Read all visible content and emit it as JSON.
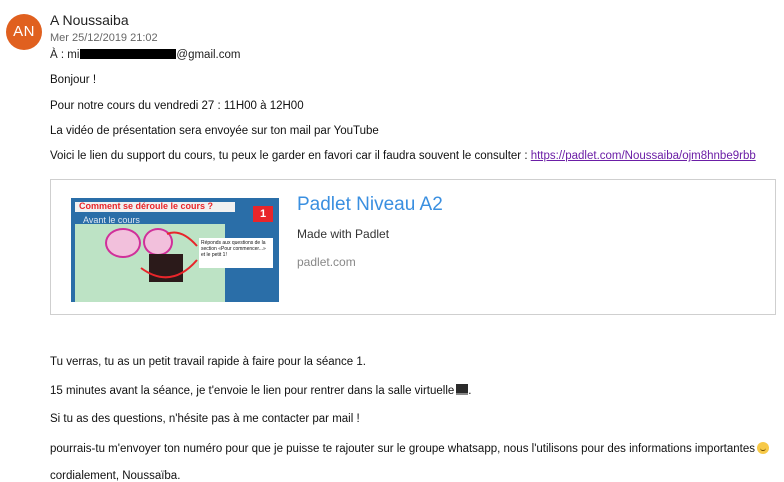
{
  "email": {
    "avatar_initials": "AN",
    "avatar_color": "#e0601f",
    "sender": "A Noussaiba",
    "date": "Mer 25/12/2019 21:02",
    "to_label": "À :",
    "to_prefix": "mi",
    "to_suffix": "@gmail.com",
    "body": {
      "greeting": "Bonjour !",
      "p1": "Pour notre cours du vendredi 27 : 11H00 à 12H00",
      "p2": "La vidéo de présentation sera envoyée sur ton mail par YouTube",
      "p3_text": "Voici le lien du support du cours, tu peux le garder en favori car il faudra souvent le consulter : ",
      "p3_link": "https://padlet.com/Noussaiba/ojm8hnbe9rbb",
      "p4": "Tu verras, tu as un petit travail rapide à faire pour la séance 1.",
      "p5": "15 minutes avant la séance, je t'envoie le lien pour rentrer dans la salle virtuelle",
      "p5_end": ".",
      "p6": "Si tu as des questions, n'hésite pas à me contacter par mail !",
      "p7": "pourrais-tu m'envoyer ton numéro pour que je puisse te rajouter sur le groupe whatsapp, nous l'utilisons pour des informations importantes",
      "signature": "cordialement, Noussaïba."
    }
  },
  "link_preview": {
    "title": "Padlet Niveau A2",
    "description": "Made with Padlet",
    "domain": "padlet.com",
    "title_color": "#3a8fe0",
    "thumbnail": {
      "title": "Comment se déroule le cours ?",
      "subtitle": "Avant le cours",
      "badge": "1",
      "note": "Réponds aux questions de la section «Pour commencer...» et le petit 1!"
    }
  }
}
